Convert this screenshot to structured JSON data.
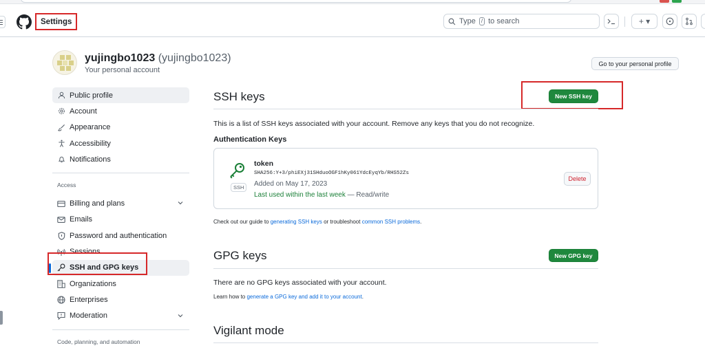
{
  "header": {
    "title": "Settings",
    "search_placeholder": "Type",
    "search_key": "/",
    "search_suffix": "to search",
    "terminal_icon": "terminal-icon",
    "plus_label": "+ ▾"
  },
  "profile": {
    "username": "yujingbo1023",
    "handle": "(yujingbo1023)",
    "subtitle": "Your personal account",
    "go_profile_label": "Go to your personal profile"
  },
  "sidebar": {
    "items_top": [
      {
        "label": "Public profile",
        "icon": "person-icon"
      },
      {
        "label": "Account",
        "icon": "gear-icon"
      },
      {
        "label": "Appearance",
        "icon": "paintbrush-icon"
      },
      {
        "label": "Accessibility",
        "icon": "accessibility-icon"
      },
      {
        "label": "Notifications",
        "icon": "bell-icon"
      }
    ],
    "access_heading": "Access",
    "items_access": [
      {
        "label": "Billing and plans",
        "icon": "credit-card-icon"
      },
      {
        "label": "Emails",
        "icon": "mail-icon"
      },
      {
        "label": "Password and authentication",
        "icon": "shield-icon"
      },
      {
        "label": "Sessions",
        "icon": "broadcast-icon"
      },
      {
        "label": "SSH and GPG keys",
        "icon": "key-icon"
      },
      {
        "label": "Organizations",
        "icon": "organization-icon"
      },
      {
        "label": "Enterprises",
        "icon": "globe-icon"
      },
      {
        "label": "Moderation",
        "icon": "report-icon"
      }
    ],
    "code_heading": "Code, planning, and automation"
  },
  "ssh": {
    "title": "SSH keys",
    "new_button": "New SSH key",
    "description": "This is a list of SSH keys associated with your account. Remove any keys that you do not recognize.",
    "auth_heading": "Authentication Keys",
    "key": {
      "name": "token",
      "fingerprint": "SHA256:Y+3/phiEXj31SHduoOGF1hKy061YdcEyqYb/RHS52Zs",
      "added": "Added on May 17, 2023",
      "last_used": "Last used within the last week",
      "access": "— Read/write",
      "badge": "SSH",
      "delete_label": "Delete"
    },
    "guide_prefix": "Check out our guide to ",
    "guide_link1": "generating SSH keys",
    "guide_mid": " or troubleshoot ",
    "guide_link2": "common SSH problems",
    "guide_suffix": "."
  },
  "gpg": {
    "title": "GPG keys",
    "new_button": "New GPG key",
    "empty": "There are no GPG keys associated with your account.",
    "learn_prefix": "Learn how to ",
    "learn_link": "generate a GPG key and add it to your account",
    "learn_suffix": "."
  },
  "vigilant": {
    "title": "Vigilant mode"
  },
  "colors": {
    "accent": "#0969da",
    "primary_green": "#1f883d",
    "danger": "#cf222e",
    "highlight_red": "#d62728"
  }
}
